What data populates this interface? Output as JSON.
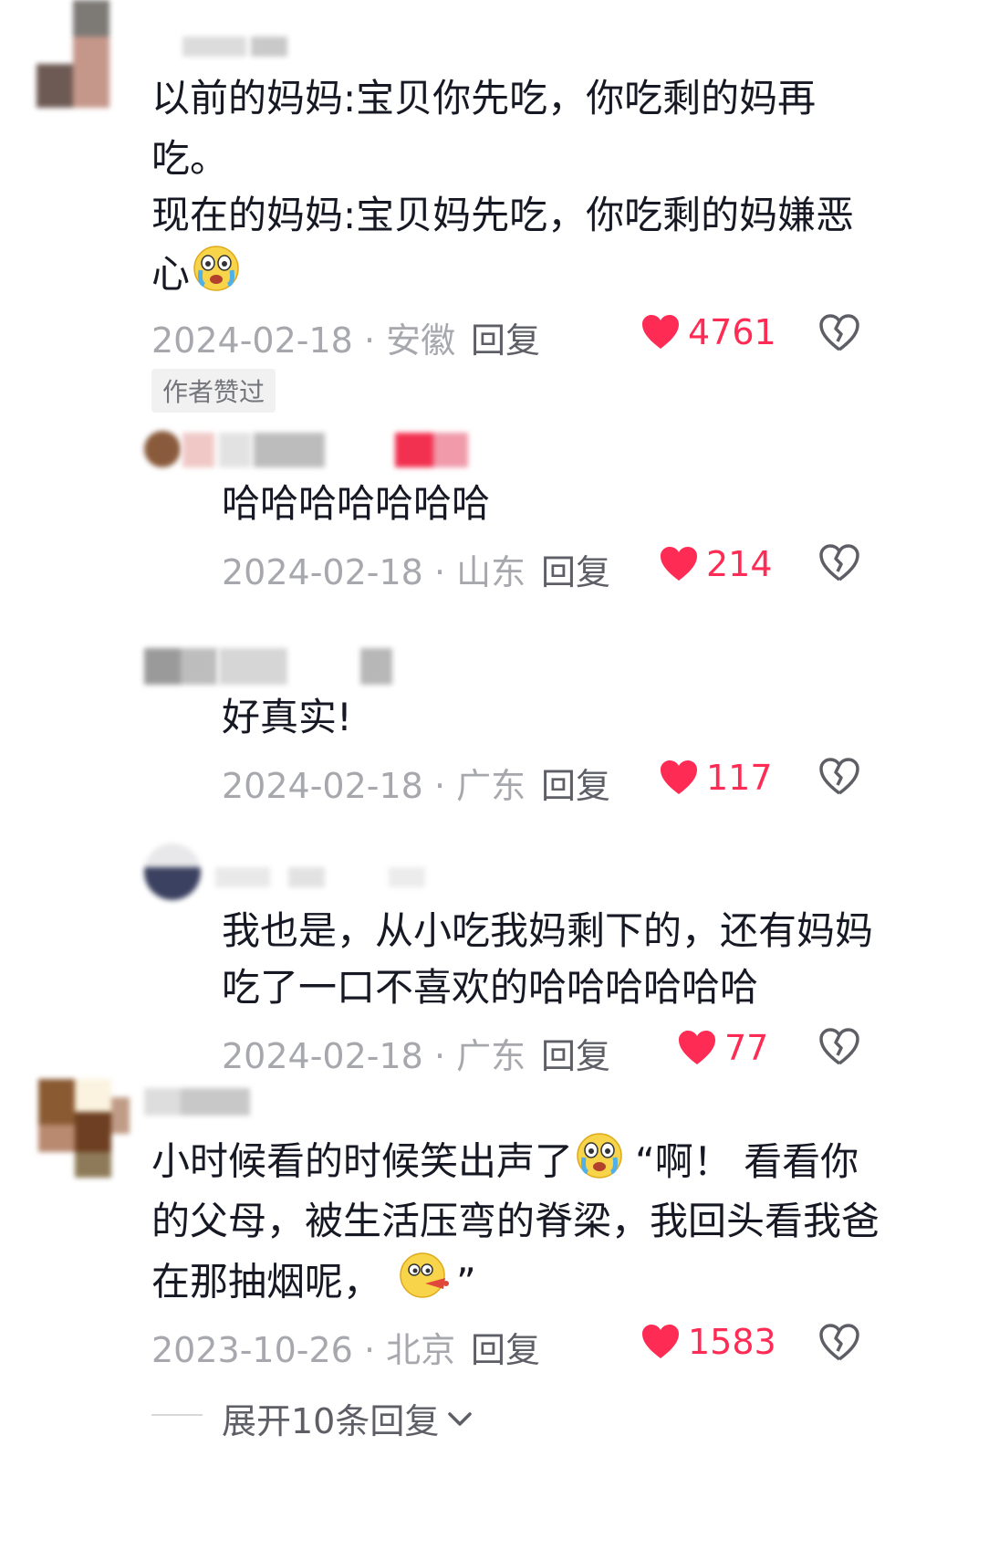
{
  "comments": [
    {
      "lines": [
        "以前的妈妈:宝贝你先吃，你吃剩的妈再",
        "吃。",
        "现在的妈妈:宝贝妈先吃，你吃剩的妈嫌恶",
        "心"
      ],
      "date": "2024-02-18",
      "sep": "·",
      "region": "安徽",
      "reply": "回复",
      "likes": "4761",
      "badge": "作者赞过"
    },
    {
      "lines": [
        "哈哈哈哈哈哈哈"
      ],
      "date": "2024-02-18",
      "sep": "·",
      "region": "山东",
      "reply": "回复",
      "likes": "214"
    },
    {
      "lines": [
        "好真实!"
      ],
      "date": "2024-02-18",
      "sep": "·",
      "region": "广东",
      "reply": "回复",
      "likes": "117"
    },
    {
      "lines": [
        "我也是，从小吃我妈剩下的，还有妈妈",
        "吃了一口不喜欢的哈哈哈哈哈哈"
      ],
      "date": "2024-02-18",
      "sep": "·",
      "region": "广东",
      "reply": "回复",
      "likes": "77"
    },
    {
      "lines": [
        "小时候看的时候笑出声了",
        "“啊！ 看看你",
        "的父母，被生活压弯的脊梁，我回头看我爸",
        "在那抽烟呢，",
        "”"
      ],
      "date": "2023-10-26",
      "sep": "·",
      "region": "北京",
      "reply": "回复",
      "likes": "1583"
    }
  ],
  "expand": {
    "label": "展开10条回复"
  },
  "icons": {
    "like": "heart-filled-icon",
    "dislike": "broken-heart-icon",
    "emoji_cry": "crying-emoji-icon",
    "emoji_spit": "spit-emoji-icon",
    "chevron": "chevron-down-icon"
  },
  "colors": {
    "like": "#fe2c55",
    "meta": "#a7a8ad",
    "text": "#161823"
  }
}
